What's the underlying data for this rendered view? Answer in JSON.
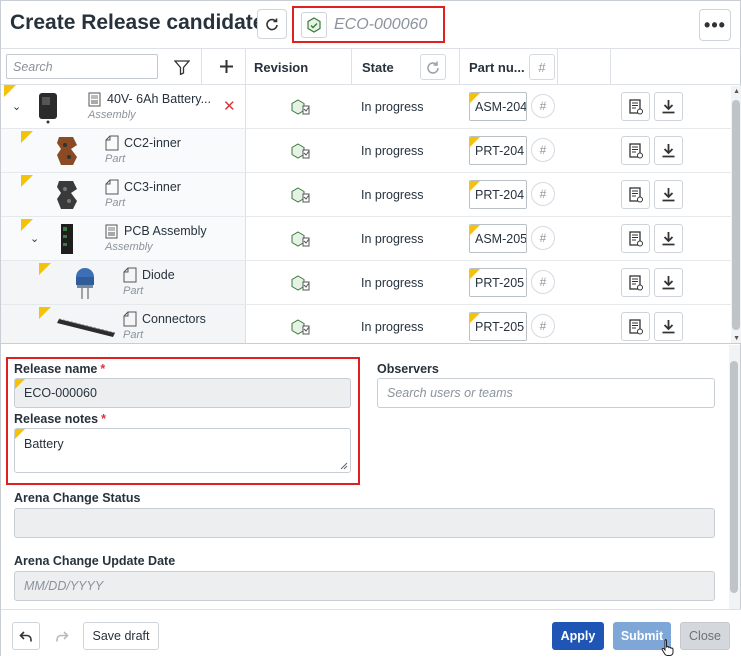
{
  "header": {
    "title": "Create Release candidate",
    "release_id": "ECO-000060"
  },
  "table": {
    "search_placeholder": "Search",
    "columns": {
      "revision": "Revision",
      "state": "State",
      "part_number": "Part nu..."
    },
    "rows": [
      {
        "name": "40V- 6Ah Battery...",
        "type": "Assembly",
        "state": "In progress",
        "part_number": "ASM-204"
      },
      {
        "name": "CC2-inner",
        "type": "Part",
        "state": "In progress",
        "part_number": "PRT-204"
      },
      {
        "name": "CC3-inner",
        "type": "Part",
        "state": "In progress",
        "part_number": "PRT-204"
      },
      {
        "name": "PCB Assembly",
        "type": "Assembly",
        "state": "In progress",
        "part_number": "ASM-205"
      },
      {
        "name": "Diode",
        "type": "Part",
        "state": "In progress",
        "part_number": "PRT-205"
      },
      {
        "name": "Connectors",
        "type": "Part",
        "state": "In progress",
        "part_number": "PRT-205"
      }
    ]
  },
  "form": {
    "release_name_label": "Release name",
    "release_name_value": "ECO-000060",
    "release_notes_label": "Release notes",
    "release_notes_value": "Battery",
    "observers_label": "Observers",
    "observers_placeholder": "Search users or teams",
    "arena_status_label": "Arena Change Status",
    "arena_status_value": "",
    "arena_date_label": "Arena Change Update Date",
    "arena_date_placeholder": "MM/DD/YYYY",
    "required_mark": "*"
  },
  "footer": {
    "save_draft": "Save draft",
    "apply": "Apply",
    "submit": "Submit",
    "close": "Close"
  },
  "colors": {
    "accent": "#1f55b4",
    "submit_disabled": "#7ea7d8",
    "marker": "#f5c20b",
    "highlight": "#e02020"
  }
}
